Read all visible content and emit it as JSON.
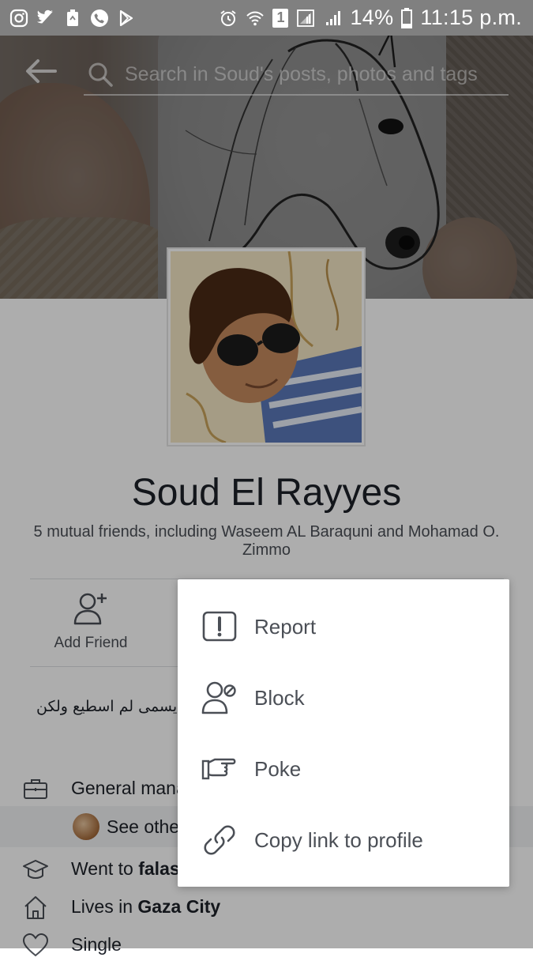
{
  "status_bar": {
    "battery": "14%",
    "time": "11:15 p.m.",
    "sim_badge": "1",
    "left_icons": [
      "instagram-icon",
      "twitter-icon",
      "recycle-icon",
      "phone-icon",
      "play-store-icon"
    ],
    "right_icons": [
      "alarm-icon",
      "wifi-icon",
      "signal-icon",
      "signal-icon",
      "battery-icon"
    ]
  },
  "search": {
    "placeholder": "Search in Soud's posts, photos and tags"
  },
  "profile": {
    "name": "Soud El Rayyes",
    "mutual_friends": "5 mutual friends, including Waseem AL Baraquni and Mohamad O. Zimmo",
    "bio": "يسمى لم اسطيع ولكن"
  },
  "actions": {
    "add_friend_label": "Add Friend"
  },
  "info": {
    "work_prefix": "General mana",
    "see_others": "See othe",
    "education_prefix": "Went to ",
    "education_bold": "falas",
    "lives_prefix": "Lives in ",
    "lives_bold": "Gaza City",
    "relationship": "Single"
  },
  "menu": {
    "items": [
      {
        "label": "Report",
        "icon": "report-icon"
      },
      {
        "label": "Block",
        "icon": "block-user-icon"
      },
      {
        "label": "Poke",
        "icon": "poke-hand-icon"
      },
      {
        "label": "Copy link to profile",
        "icon": "link-icon"
      }
    ]
  },
  "colors": {
    "status_bar": "#808080",
    "menu_text": "#4b4f56",
    "page_background": "#ffffff"
  }
}
